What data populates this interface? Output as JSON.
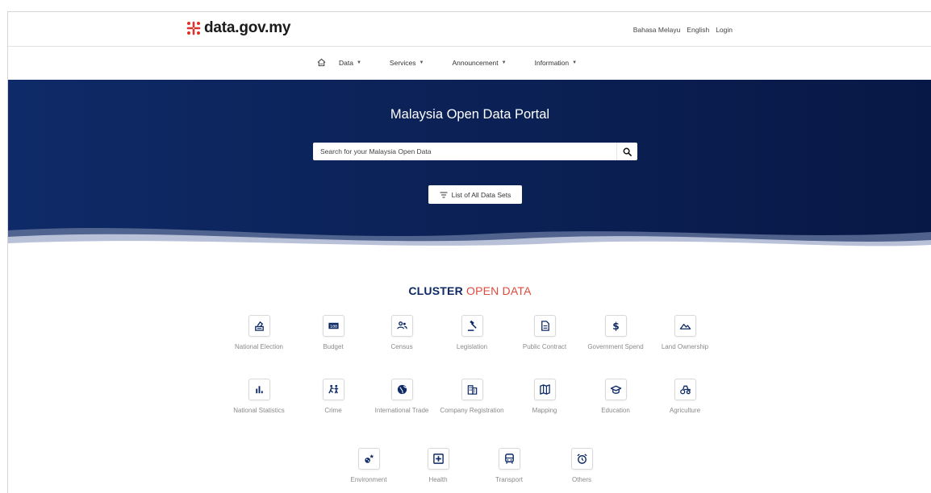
{
  "header": {
    "logo_text": "data.gov.my",
    "links": [
      "Bahasa Melayu",
      "English",
      "Login"
    ]
  },
  "nav": {
    "items": [
      {
        "label": "Data"
      },
      {
        "label": "Services"
      },
      {
        "label": "Announcement"
      },
      {
        "label": "Information"
      }
    ]
  },
  "hero": {
    "title": "Malaysia Open Data Portal",
    "search_placeholder": "Search for your Malaysia Open Data",
    "list_button": "List of All Data Sets"
  },
  "cluster": {
    "title_part1": "CLUSTER",
    "title_part2": "OPEN DATA",
    "tiles": [
      {
        "label": "National Election",
        "icon": "ballot-icon"
      },
      {
        "label": "Budget",
        "icon": "budget-icon"
      },
      {
        "label": "Census",
        "icon": "people-icon"
      },
      {
        "label": "Legislation",
        "icon": "gavel-icon"
      },
      {
        "label": "Public Contract",
        "icon": "document-icon"
      },
      {
        "label": "Government Spend",
        "icon": "dollar-icon"
      },
      {
        "label": "Land Ownership",
        "icon": "mountain-icon"
      },
      {
        "label": "National Statistics",
        "icon": "bar-chart-icon"
      },
      {
        "label": "Crime",
        "icon": "crime-icon"
      },
      {
        "label": "International Trade",
        "icon": "globe-icon"
      },
      {
        "label": "Company Registration",
        "icon": "building-icon"
      },
      {
        "label": "Mapping",
        "icon": "map-icon"
      },
      {
        "label": "Education",
        "icon": "graduation-cap-icon"
      },
      {
        "label": "Agriculture",
        "icon": "tractor-icon"
      },
      {
        "label": "Environment",
        "icon": "environment-icon"
      },
      {
        "label": "Health",
        "icon": "medical-plus-icon"
      },
      {
        "label": "Transport",
        "icon": "train-icon"
      },
      {
        "label": "Others",
        "icon": "alarm-clock-icon"
      }
    ]
  },
  "colors": {
    "navy": "#0d2a66",
    "accent_red": "#e04a3c",
    "hero_dark": "#081846"
  }
}
